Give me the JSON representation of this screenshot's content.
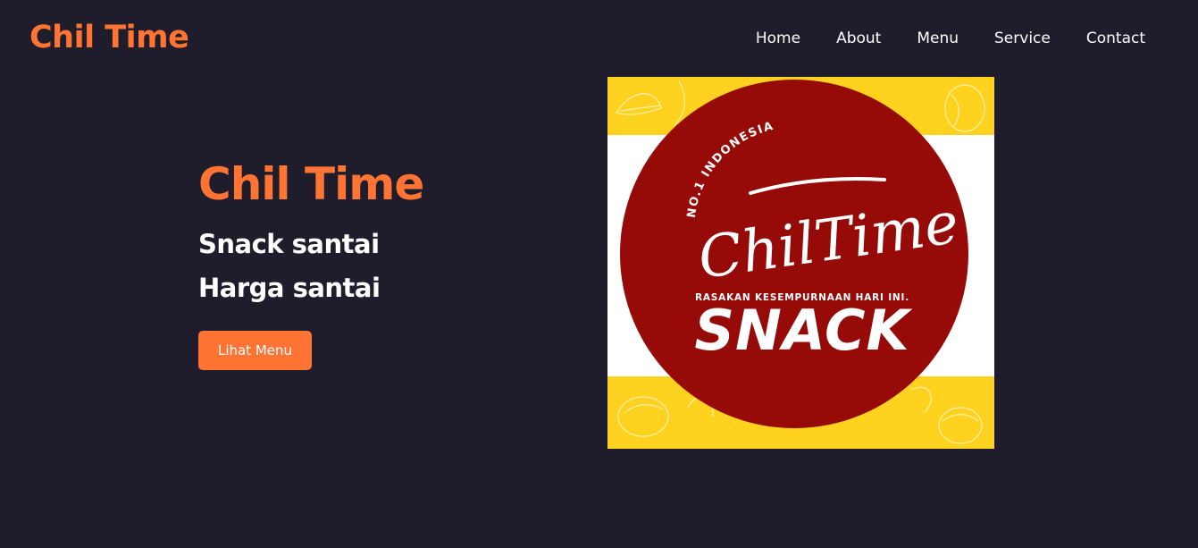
{
  "header": {
    "brand": "Chil Time",
    "nav": [
      {
        "label": "Home"
      },
      {
        "label": "About"
      },
      {
        "label": "Menu"
      },
      {
        "label": "Service"
      },
      {
        "label": "Contact"
      }
    ]
  },
  "hero": {
    "title": "Chil Time",
    "line1": "Snack santai",
    "line2": "Harga santai",
    "cta_label": "Lihat Menu",
    "logo": {
      "arc_text": "NO.1 INDONESIA",
      "script_text": "ChilTime",
      "tagline": "RASAKAN KESEMPURNAAN HARI INI.",
      "word": "SNACK"
    }
  },
  "colors": {
    "background": "#1f1d2b",
    "accent": "#ff7433",
    "text": "#ffffff",
    "logo_circle": "#960a07",
    "logo_yellow": "#ffd21f"
  }
}
